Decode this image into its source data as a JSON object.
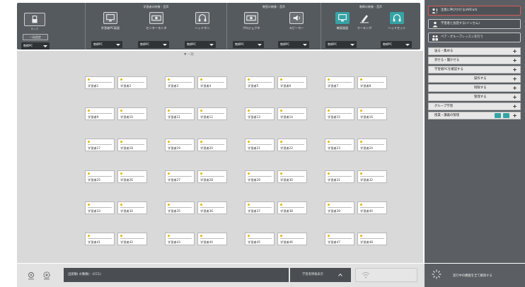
{
  "toolbar": {
    "lock_label": "ロック",
    "all_settings_label": "一括設定",
    "groups": [
      {
        "title": "学習者の映像・音声",
        "tools": [
          {
            "label": "学習者PC画面",
            "icon": "monitor-icon",
            "select": "教師PC"
          },
          {
            "label": "センターモニタ",
            "icon": "projector-icon",
            "select": "教師PC"
          },
          {
            "label": "ヘッドホン",
            "icon": "headphone-icon",
            "select": "教師PC"
          }
        ]
      },
      {
        "title": "教室の映像・音声",
        "tools": [
          {
            "label": "プロジェクタ",
            "icon": "projector-icon",
            "select": "教師PC"
          },
          {
            "label": "スピーカー",
            "icon": "speaker-icon",
            "select": "教師PC"
          }
        ]
      },
      {
        "title": "教師の映像・音声",
        "tools": [
          {
            "label": "確認画面",
            "icon": "monitor-icon",
            "select": "教師PC"
          },
          {
            "label": "マーキング",
            "icon": "pen-icon",
            "select": ""
          },
          {
            "label": "ヘッドセット",
            "icon": "headset-icon",
            "select": "教師PC"
          }
        ]
      }
    ]
  },
  "rightpanel": {
    "top_buttons": [
      {
        "label": "注意に呼びかける(ARCall)",
        "icon": "alert-person-icon"
      },
      {
        "label": "学習者と会話する(インカム)",
        "icon": "person-icon"
      },
      {
        "label": "ペア・グループレッスンを行う",
        "icon": "group-icon"
      }
    ],
    "menu": [
      {
        "label": "送る・集める",
        "indent": false
      },
      {
        "label": "見せる・聞かせる",
        "indent": false
      },
      {
        "label": "学習者PCを確認する",
        "indent": false
      },
      {
        "label": "操作する",
        "indent": true
      },
      {
        "label": "制限する",
        "indent": true
      },
      {
        "label": "管理する",
        "indent": true
      },
      {
        "label": "グループ学習",
        "indent": false
      },
      {
        "label": "授業・講義の管理",
        "indent": false
      }
    ]
  },
  "main": {
    "collapse_label": "▼ 一括",
    "students": [
      "学習者1",
      "学習者2",
      "学習者3",
      "学習者4",
      "学習者5",
      "学習者6",
      "学習者7",
      "学習者8",
      "学習者9",
      "学習者10",
      "学習者11",
      "学習者12",
      "学習者13",
      "学習者14",
      "学習者15",
      "学習者16",
      "学習者17",
      "学習者18",
      "学習者19",
      "学習者20",
      "学習者21",
      "学習者22",
      "学習者23",
      "学習者24",
      "学習者25",
      "学習者26",
      "学習者27",
      "学習者28",
      "学習者29",
      "学習者30",
      "学習者31",
      "学習者32",
      "学習者33",
      "学習者34",
      "学習者35",
      "学習者36",
      "学習者37",
      "学習者38",
      "学習者39",
      "学習者40",
      "学習者41",
      "学習者42",
      "学習者43",
      "学習者44",
      "学習者45",
      "学習者46",
      "学習者47",
      "学習者48"
    ]
  },
  "bottombar": {
    "status_text": "出席数( 4/数数) - (CC1)",
    "display_label": "学習者情報表示",
    "status_right": "実行中の機能を全て解除する"
  },
  "colors": {
    "accent": "#35a3a5",
    "toolbar_bg": "#555a5e",
    "panel_bg": "#5b5f63"
  }
}
